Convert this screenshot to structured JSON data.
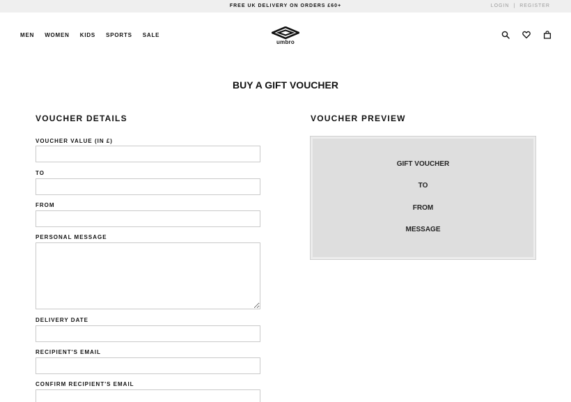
{
  "topbar": {
    "promo": "FREE UK DELIVERY ON ORDERS £60+",
    "login": "LOGIN",
    "separator": "|",
    "register": "REGISTER"
  },
  "nav": {
    "men": "MEN",
    "women": "WOMEN",
    "kids": "KIDS",
    "sports": "SPORTS",
    "sale": "SALE"
  },
  "logo": {
    "wordmark": "umbro"
  },
  "icons": [
    "search-icon",
    "heart-icon",
    "bag-icon"
  ],
  "page": {
    "title": "BUY A GIFT VOUCHER"
  },
  "details": {
    "heading": "VOUCHER DETAILS",
    "fields": [
      {
        "label": "VOUCHER VALUE (IN £)",
        "value": ""
      },
      {
        "label": "TO",
        "value": ""
      },
      {
        "label": "FROM",
        "value": ""
      },
      {
        "label": "PERSONAL MESSAGE",
        "value": ""
      },
      {
        "label": "DELIVERY DATE",
        "value": ""
      },
      {
        "label": "RECIPIENT'S EMAIL",
        "value": ""
      },
      {
        "label": "CONFIRM RECIPIENT'S EMAIL",
        "value": ""
      }
    ]
  },
  "preview": {
    "heading": "VOUCHER PREVIEW",
    "title": "GIFT VOUCHER",
    "to": "TO",
    "from": "FROM",
    "message": "MESSAGE"
  },
  "colors": {
    "topbar_bg": "#efefef",
    "preview_bg": "#dedede",
    "text": "#111111",
    "muted": "#9a9a9a",
    "input_border": "#c9c9c9"
  }
}
